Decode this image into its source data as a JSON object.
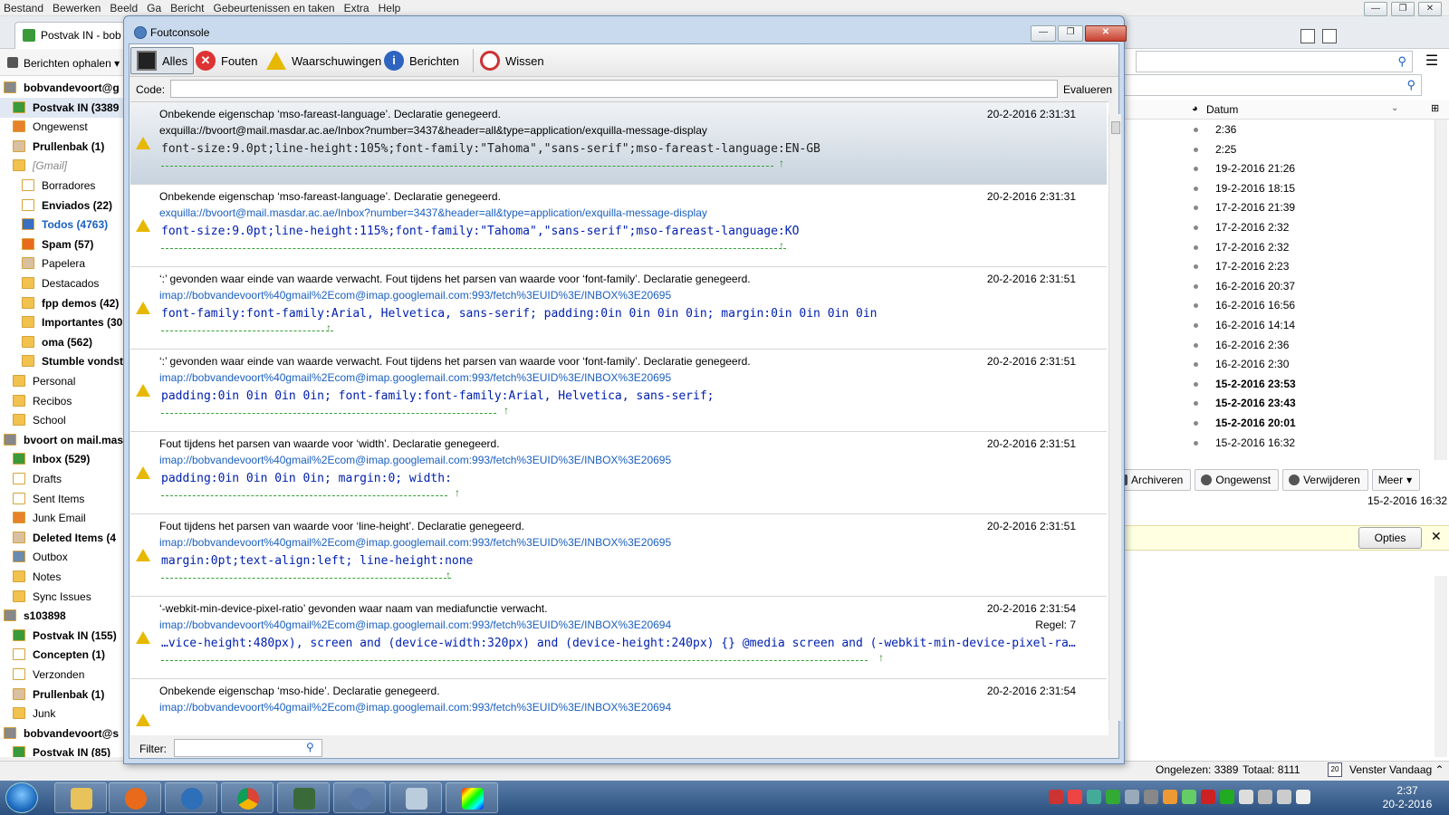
{
  "menubar": [
    "Bestand",
    "Bewerken",
    "Beeld",
    "Ga",
    "Bericht",
    "Gebeurtenissen en taken",
    "Extra",
    "Help"
  ],
  "tab": {
    "label": "Postvak IN - bob"
  },
  "toolbar": {
    "get_mail": "Berichten ophalen"
  },
  "folders": [
    {
      "label": "bobvandevoort@g",
      "bold": true,
      "icon": "account-icon"
    },
    {
      "label": "Postvak IN (3389",
      "bold": true,
      "icon": "inbox-icon",
      "selected": true
    },
    {
      "label": "Ongewenst",
      "bold": false,
      "icon": "junk-icon"
    },
    {
      "label": "Prullenbak (1)",
      "bold": true,
      "icon": "trash-icon"
    },
    {
      "label": "[Gmail]",
      "bold": false,
      "icon": "folder-icon",
      "italic": true
    },
    {
      "label": "Borradores",
      "bold": false,
      "icon": "drafts-icon"
    },
    {
      "label": "Enviados (22)",
      "bold": true,
      "icon": "sent-icon"
    },
    {
      "label": "Todos (4763)",
      "bold": true,
      "icon": "all-mail-icon",
      "blue": true
    },
    {
      "label": "Spam (57)",
      "bold": true,
      "icon": "spam-icon"
    },
    {
      "label": "Papelera",
      "bold": false,
      "icon": "trash-icon"
    },
    {
      "label": "Destacados",
      "bold": false,
      "icon": "folder-icon"
    },
    {
      "label": "fpp demos (42)",
      "bold": true,
      "icon": "folder-icon"
    },
    {
      "label": "Importantes (30",
      "bold": true,
      "icon": "folder-icon"
    },
    {
      "label": "oma (562)",
      "bold": true,
      "icon": "folder-icon"
    },
    {
      "label": "Stumble vondst",
      "bold": true,
      "icon": "folder-icon"
    },
    {
      "label": "Personal",
      "bold": false,
      "icon": "folder-icon"
    },
    {
      "label": "Recibos",
      "bold": false,
      "icon": "folder-icon"
    },
    {
      "label": "School",
      "bold": false,
      "icon": "folder-icon"
    },
    {
      "label": "bvoort on mail.mas",
      "bold": true,
      "icon": "account-icon"
    },
    {
      "label": "Inbox (529)",
      "bold": true,
      "icon": "inbox-icon"
    },
    {
      "label": "Drafts",
      "bold": false,
      "icon": "drafts-icon"
    },
    {
      "label": "Sent Items",
      "bold": false,
      "icon": "sent-icon"
    },
    {
      "label": "Junk Email",
      "bold": false,
      "icon": "junk-icon"
    },
    {
      "label": "Deleted Items (4",
      "bold": true,
      "icon": "trash-icon"
    },
    {
      "label": "Outbox",
      "bold": false,
      "icon": "outbox-icon"
    },
    {
      "label": "Notes",
      "bold": false,
      "icon": "folder-icon"
    },
    {
      "label": "Sync Issues",
      "bold": false,
      "icon": "folder-icon"
    },
    {
      "label": "s103898",
      "bold": true,
      "icon": "account-icon"
    },
    {
      "label": "Postvak IN (155)",
      "bold": true,
      "icon": "inbox-icon"
    },
    {
      "label": "Concepten (1)",
      "bold": true,
      "icon": "drafts-icon"
    },
    {
      "label": "Verzonden",
      "bold": false,
      "icon": "sent-icon"
    },
    {
      "label": "Prullenbak (1)",
      "bold": true,
      "icon": "trash-icon"
    },
    {
      "label": "Junk",
      "bold": false,
      "icon": "folder-icon"
    },
    {
      "label": "bobvandevoort@s",
      "bold": true,
      "icon": "account-icon"
    },
    {
      "label": "Postvak IN (85)",
      "bold": true,
      "icon": "inbox-icon"
    }
  ],
  "messagelist": {
    "date_header": "Datum",
    "dates": [
      {
        "v": "2:36",
        "b": false
      },
      {
        "v": "2:25",
        "b": false
      },
      {
        "v": "19-2-2016 21:26",
        "b": false
      },
      {
        "v": "19-2-2016 18:15",
        "b": false
      },
      {
        "v": "17-2-2016 21:39",
        "b": false
      },
      {
        "v": "17-2-2016 2:32",
        "b": false
      },
      {
        "v": "17-2-2016 2:32",
        "b": false
      },
      {
        "v": "17-2-2016 2:23",
        "b": false
      },
      {
        "v": "16-2-2016 20:37",
        "b": false
      },
      {
        "v": "16-2-2016 16:56",
        "b": false
      },
      {
        "v": "16-2-2016 14:14",
        "b": false
      },
      {
        "v": "16-2-2016 2:36",
        "b": false
      },
      {
        "v": "16-2-2016 2:30",
        "b": false
      },
      {
        "v": "15-2-2016 23:53",
        "b": true
      },
      {
        "v": "15-2-2016 23:43",
        "b": true
      },
      {
        "v": "15-2-2016 20:01",
        "b": true
      },
      {
        "v": "15-2-2016 16:32",
        "b": false
      }
    ]
  },
  "header_actions": {
    "archive": "Archiveren",
    "junk": "Ongewenst",
    "delete": "Verwijderen",
    "more": "Meer"
  },
  "header_date": "15-2-2016 16:32",
  "notification": {
    "options": "Opties"
  },
  "statusbar": {
    "unread": "Ongelezen: 3389",
    "total": "Totaal: 8111",
    "today": "Venster Vandaag",
    "cal_day": "20"
  },
  "clock": {
    "time": "2:37",
    "date": "20-2-2016"
  },
  "console": {
    "title": "Foutconsole",
    "tabs": [
      {
        "label": "Alles",
        "icon": "console-icon",
        "selected": true
      },
      {
        "label": "Fouten",
        "icon": "error-icon"
      },
      {
        "label": "Waarschuwingen",
        "icon": "warning-icon"
      },
      {
        "label": "Berichten",
        "icon": "info-icon"
      },
      {
        "label": "Wissen",
        "icon": "clear-icon"
      }
    ],
    "code_label": "Code:",
    "evaluate": "Evalueren",
    "filter_label": "Filter:",
    "entries": [
      {
        "msg": "Onbekende eigenschap ‘mso-fareast-language’.  Declaratie genegeerd.",
        "src": "exquilla://bvoort@mail.masdar.ac.ae/Inbox?number=3437&header=all&type=application/exquilla-message-display",
        "code": "font-size:9.0pt;line-height:105%;font-family:\"Tahoma\",\"sans-serif\";mso-fareast-language:EN-GB",
        "time": "20-2-2016 2:31:31",
        "regel": "",
        "sel": true
      },
      {
        "msg": "Onbekende eigenschap ‘mso-fareast-language’.  Declaratie genegeerd.",
        "src": "exquilla://bvoort@mail.masdar.ac.ae/Inbox?number=3437&header=all&type=application/exquilla-message-display",
        "code": "font-size:9.0pt;line-height:115%;font-family:\"Tahoma\",\"sans-serif\";mso-fareast-language:KO",
        "time": "20-2-2016 2:31:31",
        "regel": "",
        "sel": false
      },
      {
        "msg": "‘:’ gevonden waar einde van waarde verwacht.  Fout tijdens het parsen van waarde voor ‘font-family’.  Declaratie genegeerd.",
        "src": "imap://bobvandevoort%40gmail%2Ecom@imap.googlemail.com:993/fetch%3EUID%3E/INBOX%3E20695",
        "code": "font-family:font-family:Arial, Helvetica, sans-serif; padding:0in 0in 0in 0in; margin:0in 0in 0in 0in",
        "time": "20-2-2016 2:31:51",
        "regel": "",
        "sel": false
      },
      {
        "msg": "‘:’ gevonden waar einde van waarde verwacht.  Fout tijdens het parsen van waarde voor ‘font-family’.  Declaratie genegeerd.",
        "src": "imap://bobvandevoort%40gmail%2Ecom@imap.googlemail.com:993/fetch%3EUID%3E/INBOX%3E20695",
        "code": "padding:0in 0in 0in 0in; font-family:font-family:Arial, Helvetica, sans-serif;",
        "time": "20-2-2016 2:31:51",
        "regel": "",
        "sel": false
      },
      {
        "msg": "Fout tijdens het parsen van waarde voor ‘width’.  Declaratie genegeerd.",
        "src": "imap://bobvandevoort%40gmail%2Ecom@imap.googlemail.com:993/fetch%3EUID%3E/INBOX%3E20695",
        "code": "padding:0in 0in 0in 0in; margin:0; width:",
        "time": "20-2-2016 2:31:51",
        "regel": "",
        "sel": false
      },
      {
        "msg": "Fout tijdens het parsen van waarde voor ‘line-height’.  Declaratie genegeerd.",
        "src": "imap://bobvandevoort%40gmail%2Ecom@imap.googlemail.com:993/fetch%3EUID%3E/INBOX%3E20695",
        "code": "margin:0pt;text-align:left; line-height:none",
        "time": "20-2-2016 2:31:51",
        "regel": "",
        "sel": false
      },
      {
        "msg": "‘-webkit-min-device-pixel-ratio’ gevonden waar naam van mediafunctie verwacht.",
        "src": "imap://bobvandevoort%40gmail%2Ecom@imap.googlemail.com:993/fetch%3EUID%3E/INBOX%3E20694",
        "code": "…vice-height:480px), screen and (device-width:320px) and (device-height:240px) {} @media screen and (-webkit-min-device-pixel-ra…",
        "time": "20-2-2016 2:31:54",
        "regel": "Regel:  7",
        "sel": false
      },
      {
        "msg": "Onbekende eigenschap ‘mso-hide’.  Declaratie genegeerd.",
        "src": "imap://bobvandevoort%40gmail%2Ecom@imap.googlemail.com:993/fetch%3EUID%3E/INBOX%3E20694",
        "code": "",
        "time": "20-2-2016 2:31:54",
        "regel": "",
        "sel": false
      }
    ]
  }
}
